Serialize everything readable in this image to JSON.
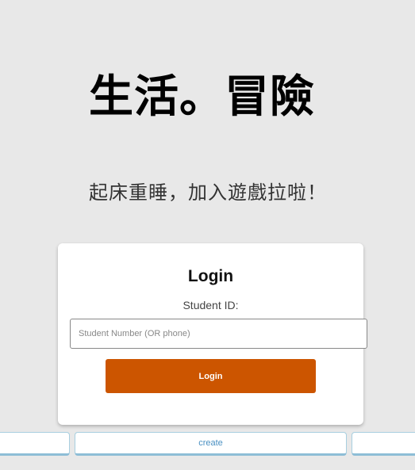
{
  "header": {
    "title": "生活。冒險",
    "subtitle": "起床重睡，加入遊戲拉啦！"
  },
  "login": {
    "heading": "Login",
    "student_id_label": "Student ID:",
    "student_input_placeholder": "Student Number (OR phone)",
    "student_input_value": "",
    "login_button_label": "Login"
  },
  "bottom_nav": {
    "left_label": "",
    "center_label": "create",
    "right_label": ""
  },
  "colors": {
    "background": "#e8e8e8",
    "login_button": "#cc5500",
    "tab_text": "#4a90c2"
  }
}
